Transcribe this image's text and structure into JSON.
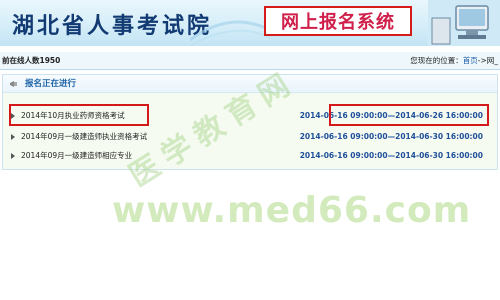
{
  "header": {
    "site_title": "湖北省人事考试院",
    "system_title": "网上报名系统"
  },
  "statusbar": {
    "online_count": "前在线人数1950",
    "location_prefix": "您现在的位置：",
    "crumb_home": "首页",
    "crumb_rest": "->网_"
  },
  "panel": {
    "title": "报名正在进行",
    "rows": [
      {
        "name": "2014年10月执业药师资格考试",
        "period": "2014-06-16 09:00:00—2014-06-26 16:00:00"
      },
      {
        "name": "2014年09月一级建造师执业资格考试",
        "period": "2014-06-16 09:00:00—2014-06-30 16:00:00"
      },
      {
        "name": "2014年09月一级建造师相应专业",
        "period": "2014-06-16 09:00:00—2014-06-30 16:00:00"
      }
    ]
  },
  "watermarks": {
    "stamp": "医学教育网",
    "url": "www.med66.com"
  },
  "colors": {
    "highlight": "#d4191b",
    "link": "#1d64a7",
    "period": "#1f4f9a"
  }
}
